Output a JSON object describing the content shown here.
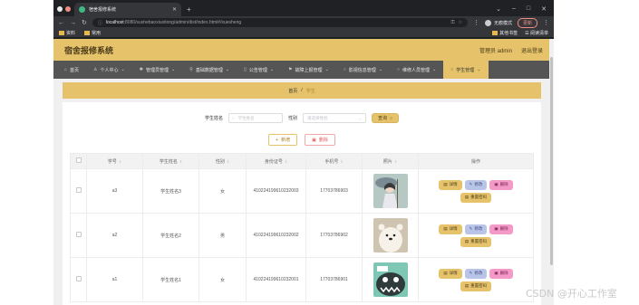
{
  "browser": {
    "tab_title": "宿舍报修系统",
    "url_host": "localhost",
    "url_rest": ":8080/sushebaoxiuxitong/admin/dist/index.html#/xuesheng",
    "profile": "无痕模式",
    "update": "更新",
    "bookmarks": [
      "资料",
      "常用"
    ],
    "bookmarks_right": [
      "其他书签",
      "阅读清单"
    ]
  },
  "app": {
    "title": "宿舍报修系统",
    "user": "管理员 admin",
    "logout": "退出登录"
  },
  "nav": [
    {
      "label": "首页",
      "icon": "home-icon"
    },
    {
      "label": "个人中心",
      "icon": "user-icon"
    },
    {
      "label": "管理员管理",
      "icon": "star-icon"
    },
    {
      "label": "基础数据管理",
      "icon": "pin-icon"
    },
    {
      "label": "公告管理",
      "icon": "bell-icon"
    },
    {
      "label": "故障上报管理",
      "icon": "flag-icon"
    },
    {
      "label": "影视信息管理",
      "icon": "circle-icon"
    },
    {
      "label": "维修人员管理",
      "icon": "circle-icon"
    },
    {
      "label": "学生管理",
      "icon": "circle-icon"
    }
  ],
  "breadcrumb": {
    "home": "首页",
    "sep": "/",
    "current": "学生"
  },
  "search": {
    "name_label": "学生姓名",
    "name_placeholder": "学生姓名",
    "gender_label": "性别",
    "gender_placeholder": "请选择性别",
    "query_button": "查询"
  },
  "actions": {
    "add": "新增",
    "delete": "删除"
  },
  "table": {
    "headers": [
      "学号",
      "学生姓名",
      "性别",
      "身份证号",
      "手机号",
      "照片",
      "操作"
    ],
    "rows": [
      {
        "no": "a3",
        "name": "学生姓名3",
        "gender": "女",
        "idcard": "410224199610232003",
        "phone": "17703786903"
      },
      {
        "no": "a2",
        "name": "学生姓名2",
        "gender": "男",
        "idcard": "410224199610232002",
        "phone": "17703786902"
      },
      {
        "no": "a1",
        "name": "学生姓名1",
        "gender": "女",
        "idcard": "410224199610232001",
        "phone": "17703786901"
      }
    ],
    "ops": {
      "detail": "详情",
      "edit": "修改",
      "remove": "删除",
      "reset": "重置密码"
    }
  },
  "watermark": "CSDN @开心工作室"
}
